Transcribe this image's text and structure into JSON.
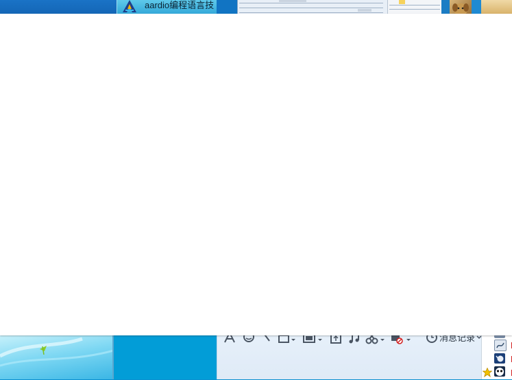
{
  "taskbar": {
    "active_task_label": "aardio编程语言技"
  },
  "chat_toolbar": {
    "history_label": "消息记录"
  },
  "colors": {
    "popup_background": "#ffffff",
    "taskbar_blue": "#1466b6",
    "active_task": "#35a9d9",
    "panel_blue": "#029dd7",
    "toolbar_bg": "#e3edf8",
    "red_marker": "#d21f1f"
  }
}
